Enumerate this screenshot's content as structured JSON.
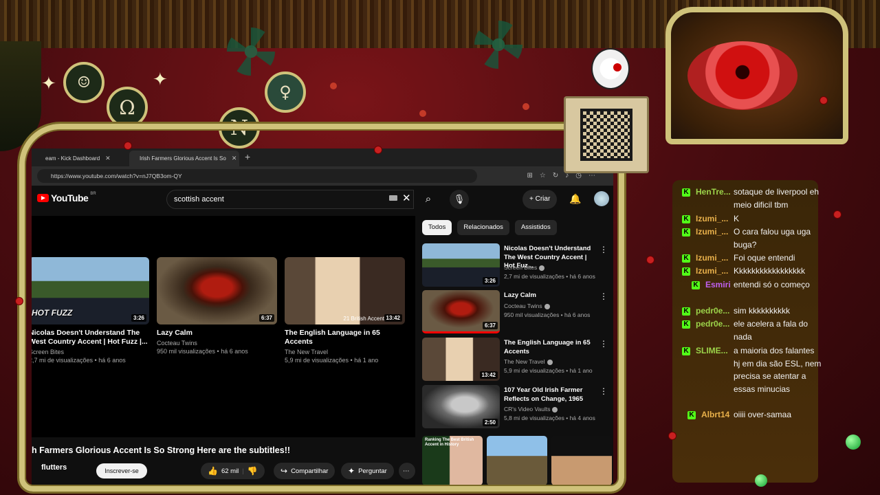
{
  "browser": {
    "tabs": [
      {
        "label": "eam - Kick Dashboard",
        "active": false
      },
      {
        "label": "Irish Farmers Glorious Accent Is So",
        "active": true
      }
    ],
    "url": "https://www.youtube.com/watch?v=nJ7QB3om-QY"
  },
  "youtube": {
    "logo": "YouTube",
    "region": "BR",
    "search_value": "scottish accent",
    "create_label": "Criar",
    "end_cards": [
      {
        "title": "Nicolas Doesn't Understand The West Country Accent | Hot Fuzz |...",
        "channel": "Screen Bites",
        "meta": "2,7 mi de visualizações • há 6 anos",
        "duration": "3:26",
        "tag": "HOT FUZZ"
      },
      {
        "title": "Lazy Calm",
        "channel": "Cocteau Twins",
        "meta": "950 mil visualizações • há 6 anos",
        "duration": "6:37"
      },
      {
        "title": "The English Language in 65 Accents",
        "channel": "The New Travel",
        "meta": "5,9 mi de visualizações • há 1 ano",
        "duration": "13:42",
        "caption": "21 British Accent"
      }
    ],
    "video_title": "h Farmers Glorious Accent Is So Strong Here are the subtitles!!",
    "channel_name": "flutters",
    "subscribe_label": "Inscrever-se",
    "like_count": "62 mil",
    "share_label": "Compartilhar",
    "ask_label": "Perguntar",
    "chips": [
      "Todos",
      "Relacionados",
      "Assistidos"
    ],
    "related": [
      {
        "title": "Nicolas Doesn't Understand The West Country Accent | Hot Fuz...",
        "channel": "Screen Bites",
        "meta": "2,7 mi de visualizações • há 6 anos",
        "duration": "3:26"
      },
      {
        "title": "Lazy Calm",
        "channel": "Cocteau Twins",
        "meta": "950 mil visualizações • há 6 anos",
        "duration": "6:37"
      },
      {
        "title": "The English Language in 65 Accents",
        "channel": "The New Travel",
        "meta": "5,9 mi de visualizações • há 1 ano",
        "duration": "13:42"
      },
      {
        "title": "107 Year Old Irish Farmer Reflects on Change, 1965",
        "channel": "CR's Video Vaults",
        "meta": "5,8 mi de visualizações • há 4 anos",
        "duration": "2:50"
      }
    ],
    "bottom_thumb_text": "Ranking The Best British Accent in History"
  },
  "chat": [
    {
      "user": "HenTre...",
      "color": "#9cd34a",
      "message": "sotaque de liverpool eh meio dificil tbm"
    },
    {
      "user": "Izumi_...",
      "color": "#e8b04a",
      "message": "K"
    },
    {
      "user": "Izumi_...",
      "color": "#e8b04a",
      "message": "O cara falou uga uga buga?"
    },
    {
      "user": "Izumi_...",
      "color": "#e8b04a",
      "message": "Foi oque entendi"
    },
    {
      "user": "Izumi_...",
      "color": "#e8b04a",
      "message": "Kkkkkkkkkkkkkkkkk"
    },
    {
      "user": "Esmiri",
      "color": "#c060f0",
      "message": "entendi só o começo"
    },
    {
      "user": "pedr0e...",
      "color": "#9cd34a",
      "message": "sim kkkkkkkkkk"
    },
    {
      "user": "pedr0e...",
      "color": "#9cd34a",
      "message": "ele acelera a fala do nada"
    },
    {
      "user": "SLIME...",
      "color": "#9cd34a",
      "message": "a maioria dos falantes hj em dia são ESL, nem precisa se atentar a essas minucias"
    },
    {
      "user": "Albrt14",
      "color": "#e8b04a",
      "message": "oiiii over-samaa"
    }
  ],
  "overlay": {
    "medallion_letter": "N"
  },
  "colors": {
    "accent_red": "#ff0000",
    "kick_green": "#53fc18",
    "frame_gold": "#cfc27a"
  }
}
